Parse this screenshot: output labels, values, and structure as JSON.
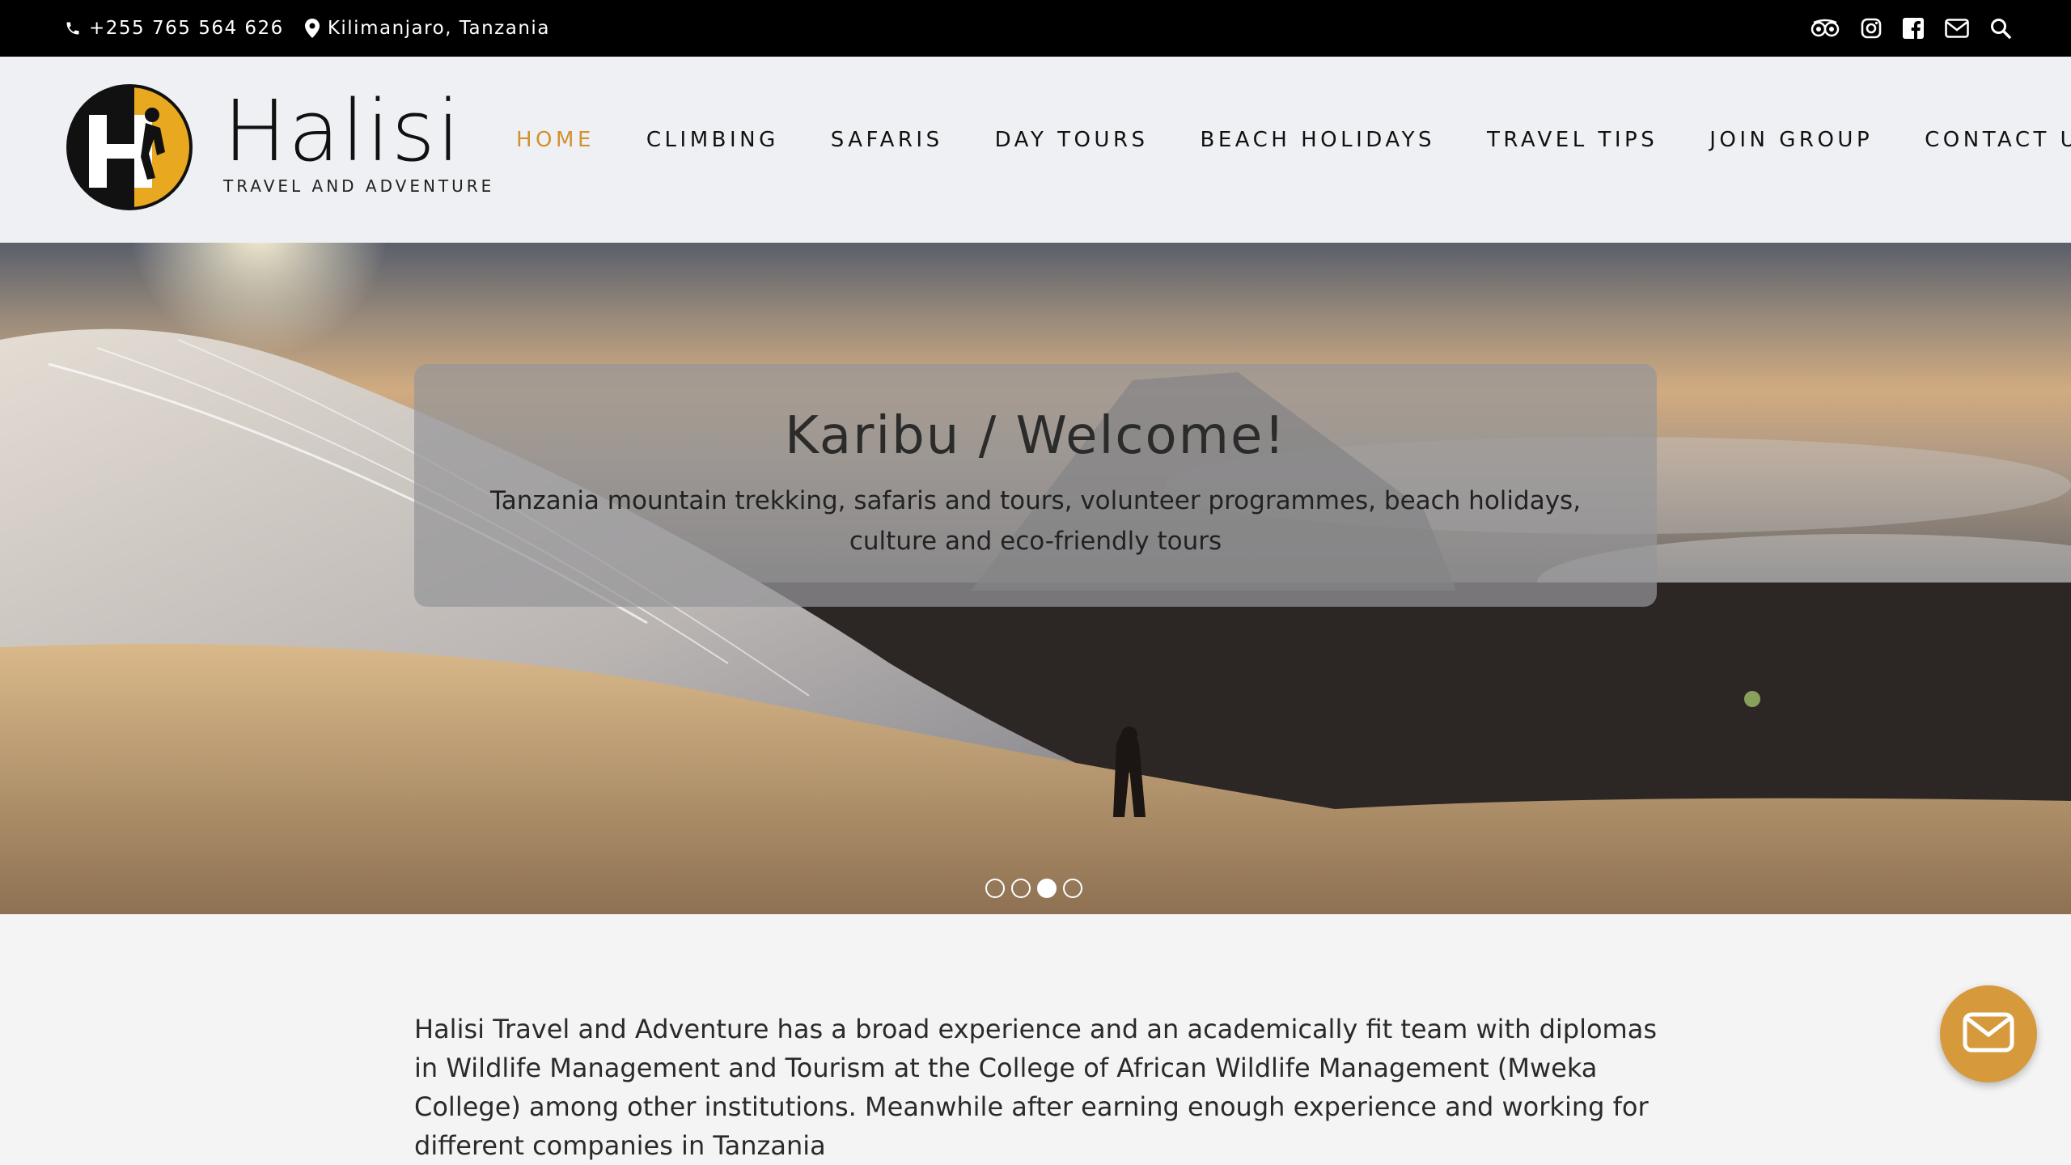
{
  "topbar": {
    "phone": "+255 765 564 626",
    "location": "Kilimanjaro, Tanzania",
    "icons": [
      "tripadvisor-icon",
      "instagram-icon",
      "facebook-icon",
      "mail-icon",
      "search-icon"
    ]
  },
  "brand": {
    "name": "Halisi",
    "tagline": "TRAVEL AND ADVENTURE",
    "logo_letter": "H"
  },
  "nav": {
    "items": [
      {
        "label": "HOME",
        "active": true
      },
      {
        "label": "CLIMBING",
        "active": false
      },
      {
        "label": "SAFARIS",
        "active": false
      },
      {
        "label": "DAY TOURS",
        "active": false
      },
      {
        "label": "BEACH HOLIDAYS",
        "active": false
      },
      {
        "label": "TRAVEL TIPS",
        "active": false
      },
      {
        "label": "JOIN GROUP",
        "active": false
      },
      {
        "label": "CONTACT US",
        "active": false
      }
    ]
  },
  "hero": {
    "title": "Karibu / Welcome!",
    "subtitle": "Tanzania mountain trekking, safaris and tours, volunteer programmes, beach holidays, culture and eco-friendly tours",
    "slide_count": 4,
    "active_slide": 3
  },
  "content": {
    "intro": "Halisi Travel and Adventure has a broad experience and an academically fit team with diplomas in Wildlife Management and Tourism at the College of African Wildlife Management (Mweka College) among other institutions. Meanwhile after earning enough experience and working for different companies in Tanzania"
  },
  "colors": {
    "accent": "#d2922f",
    "topbar_bg": "#000000",
    "header_bg": "#eef0f3",
    "fab_bg": "#d69a3c"
  }
}
